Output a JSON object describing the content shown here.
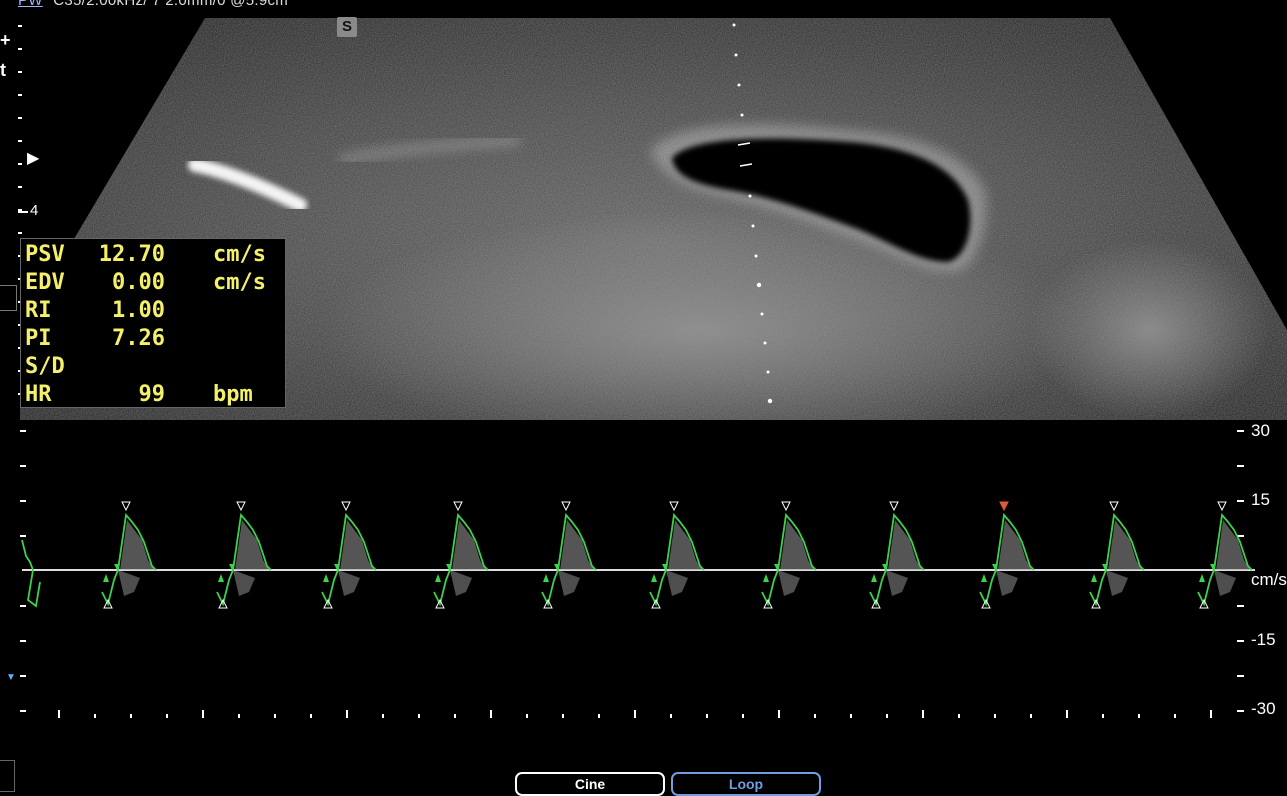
{
  "header": {
    "mode_label": "PW",
    "params": "C35/2.00kHz/ 7 2.0mm/0 @5.9cm"
  },
  "image": {
    "marker": "S",
    "depth_marker": "4",
    "left_plus": "+",
    "left_t": "t"
  },
  "measurements": [
    {
      "label": "PSV",
      "value": "12.70",
      "unit": "cm/s"
    },
    {
      "label": "EDV",
      "value": "0.00",
      "unit": "cm/s"
    },
    {
      "label": "RI",
      "value": "1.00",
      "unit": ""
    },
    {
      "label": "PI",
      "value": "7.26",
      "unit": ""
    },
    {
      "label": "S/D",
      "value": "",
      "unit": ""
    },
    {
      "label": "HR",
      "value": "99",
      "unit": "bpm"
    }
  ],
  "doppler": {
    "scale_labels": [
      "30",
      "15",
      "cm/s",
      "-15",
      "-30"
    ],
    "unit": "cm/s",
    "wave_color": "#3cd24a",
    "peak_marker_color": "#e05a3a",
    "baseline_color": "#dddddd"
  },
  "buttons": {
    "cine": "Cine",
    "loop": "Loop"
  }
}
